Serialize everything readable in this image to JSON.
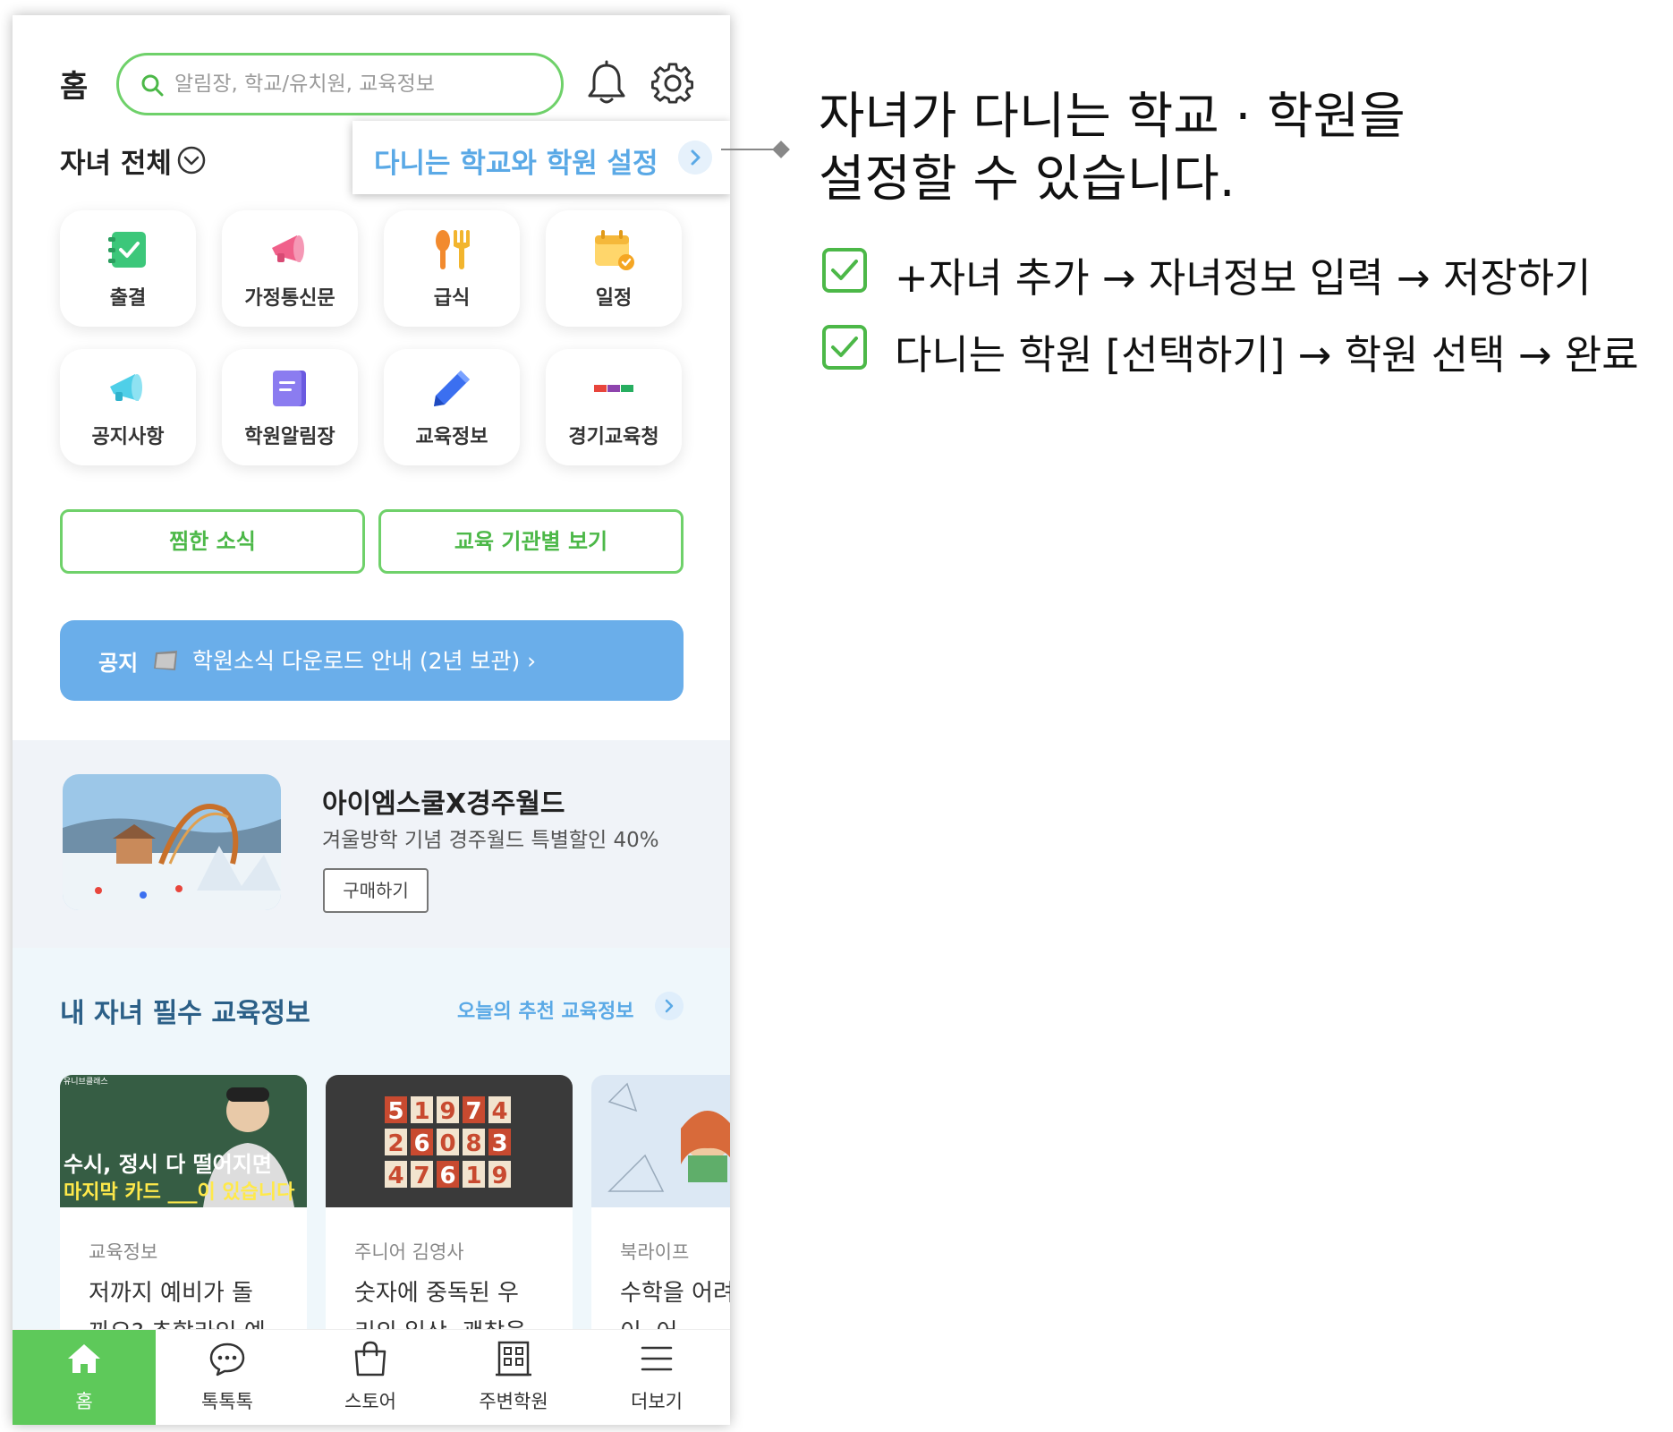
{
  "header": {
    "title": "홈",
    "search_placeholder": "알림장, 학교/유치원, 교육정보"
  },
  "child_selector": "자녀 전체",
  "callout": "다니는 학교와 학원 설정",
  "menu": [
    {
      "label": "출결",
      "icon": "attendance-icon"
    },
    {
      "label": "가정통신문",
      "icon": "megaphone-icon"
    },
    {
      "label": "급식",
      "icon": "meal-icon"
    },
    {
      "label": "일정",
      "icon": "calendar-icon"
    },
    {
      "label": "공지사항",
      "icon": "announcement-icon"
    },
    {
      "label": "학원알림장",
      "icon": "notebook-icon"
    },
    {
      "label": "교육정보",
      "icon": "pencil-icon"
    },
    {
      "label": "경기교육청",
      "icon": "gyeonggi-logo-icon"
    }
  ],
  "buttons": {
    "liked_news": "찜한 소식",
    "by_institution": "교육 기관별 보기"
  },
  "notice": {
    "tag": "공지",
    "text": "학원소식 다운로드 안내 (2년 보관) ›"
  },
  "promo": {
    "title": "아이엠스쿨X경주월드",
    "subtitle": "겨울방학 기념 경주월드 특별할인 40%",
    "button": "구매하기"
  },
  "edu": {
    "title": "내 자녀 필수 교육정보",
    "link": "오늘의 추천 교육정보",
    "cards": [
      {
        "category": "교육정보",
        "text": "저까지 예비가 돌 까요? 추합라인 예",
        "thumb_line1": "수시, 정시 다 떨어지면",
        "thumb_line2": "마지막 카드 ___이 있습니다",
        "thumb_tag": "유니브클래스"
      },
      {
        "category": "주니어 김영사",
        "text": "숫자에 중독된 우 리의 일상, 괜찮을",
        "digits": [
          "5",
          "1",
          "9",
          "7",
          "4",
          "2",
          "6",
          "0",
          "8",
          "3",
          "4",
          "7",
          "6",
          "1",
          "9"
        ]
      },
      {
        "category": "북라이프",
        "text": "수학을 어려 는 아이, 어"
      }
    ]
  },
  "bottom_nav": [
    {
      "label": "홈",
      "icon": "home-icon",
      "active": true
    },
    {
      "label": "톡톡톡",
      "icon": "chat-icon",
      "active": false
    },
    {
      "label": "스토어",
      "icon": "shopping-bag-icon",
      "active": false
    },
    {
      "label": "주변학원",
      "icon": "building-icon",
      "active": false
    },
    {
      "label": "더보기",
      "icon": "menu-icon",
      "active": false
    }
  ],
  "annotation": {
    "title_line1": "자녀가 다니는 학교 · 학원을",
    "title_line2": "설정할 수 있습니다.",
    "step1": "+자녀 추가 → 자녀정보 입력 → 저장하기",
    "step2": "다니는 학원 [선택하기] → 학원 선택 → 완료"
  },
  "colors": {
    "accent_green": "#6fd16a",
    "accent_blue": "#5aa9e6",
    "notice_blue": "#6aaeea",
    "edu_title": "#2b5f87"
  }
}
